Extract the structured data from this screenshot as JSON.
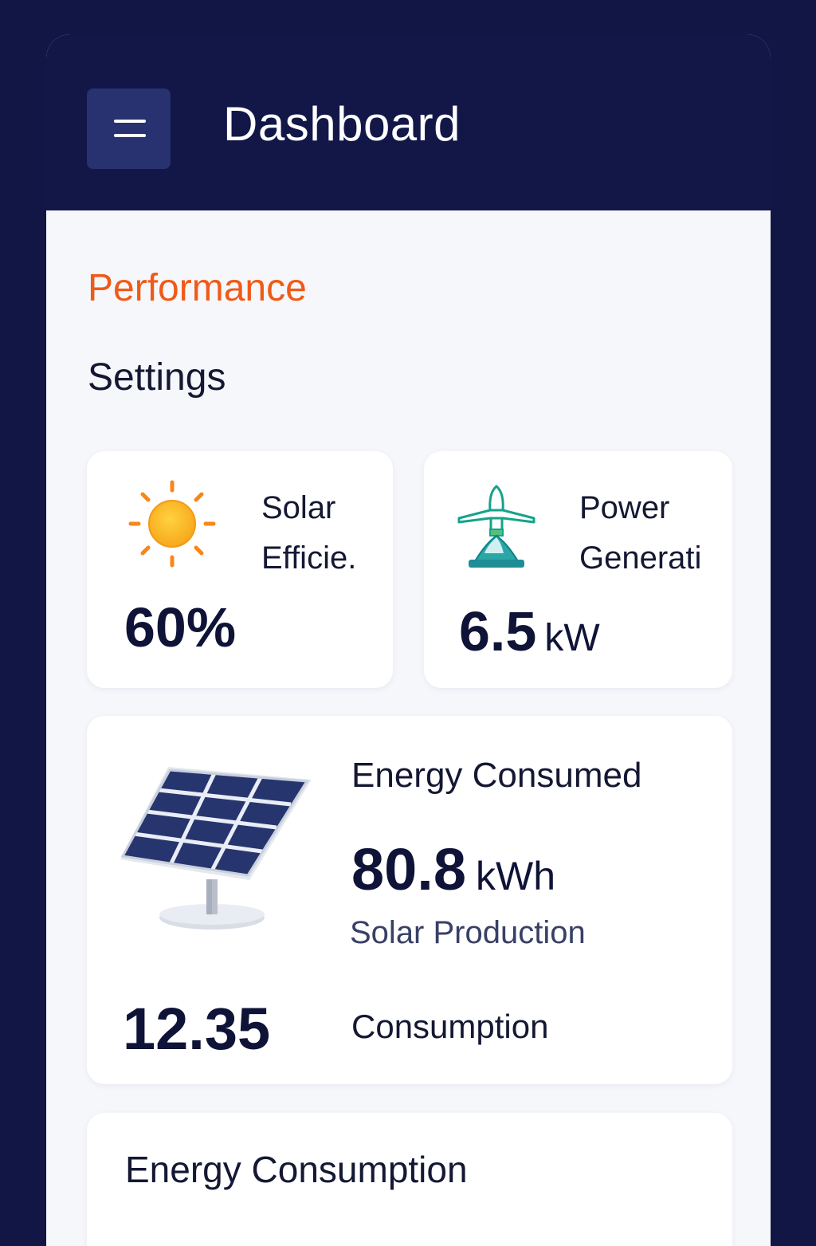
{
  "header": {
    "title": "Dashboard",
    "menu_icon": "hamburger-menu-icon"
  },
  "main": {
    "section_title": "Performance",
    "subsection_title": "Settings"
  },
  "cards": {
    "solar_efficiency": {
      "icon": "sun-icon",
      "label_line1": "Solar",
      "label_line2": "Efficie.",
      "value": "60%"
    },
    "power_generation": {
      "icon": "power-tower-icon",
      "label_line1": "Power",
      "label_line2": "Generati",
      "value": "6.5",
      "unit": "kW"
    },
    "energy": {
      "icon": "solar-panel-icon",
      "label": "Energy Consumed",
      "value": "80.8",
      "unit": "kWh",
      "sub_label": "Solar Production",
      "secondary_value": "12.35",
      "secondary_label": "Consumption"
    },
    "energy_consumption": {
      "title": "Energy Consumption"
    }
  },
  "colors": {
    "background": "#111645",
    "header": "#121748",
    "menu_button": "#293270",
    "accent": "#f05a17",
    "content_bg": "#f6f7fb",
    "text_dark": "#0f1337"
  }
}
